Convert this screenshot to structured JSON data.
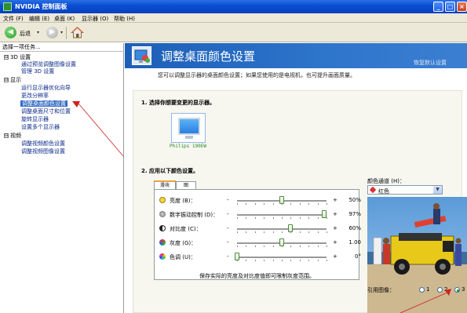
{
  "window": {
    "title": "NVIDIA 控制面板",
    "controls": {
      "minimize": "_",
      "maximize": "□",
      "close": "×"
    }
  },
  "menu": [
    "文件 (F)",
    "编辑 (E)",
    "桌面 (K)",
    "显示器 (O)",
    "帮助 (H)"
  ],
  "toolbar": {
    "back_label": "后退",
    "dropdown": "▾"
  },
  "sidebar": {
    "header": "选择一项任务...",
    "tree": [
      {
        "label": "3D 设置",
        "type": "group",
        "expander": "⊟"
      },
      {
        "label": "通过预览调整图像设置",
        "type": "link"
      },
      {
        "label": "管理 3D 设置",
        "type": "link"
      },
      {
        "label": "显示",
        "type": "group",
        "expander": "⊟"
      },
      {
        "label": "运行显示器优化向导",
        "type": "link"
      },
      {
        "label": "更改分辨率",
        "type": "link"
      },
      {
        "label": "调整桌面颜色设置",
        "type": "link",
        "selected": true
      },
      {
        "label": "调整桌面尺寸和位置",
        "type": "link"
      },
      {
        "label": "旋转显示器",
        "type": "link"
      },
      {
        "label": "设置多个显示器",
        "type": "link"
      },
      {
        "label": "视频",
        "type": "group",
        "expander": "⊟"
      },
      {
        "label": "调整视频颜色设置",
        "type": "link"
      },
      {
        "label": "调整视频图像设置",
        "type": "link"
      }
    ]
  },
  "main": {
    "title": "调整桌面颜色设置",
    "restore_defaults": "恢复默认设置",
    "description": "您可以调整显示器的桌面颜色设置；如果您使用的是电视机，也可提升画面质量。",
    "section1": "1.  选择你想要变更的显示器。",
    "monitor_label": "Philips 190EW",
    "section2": "2.  应用以下颜色设置。",
    "tabs": [
      "滑块",
      "图"
    ],
    "properties": [
      {
        "label": "亮度 (B)：",
        "value": "50%",
        "level": 0.5,
        "icon_color": "#e8c020",
        "icon": "sun-icon"
      },
      {
        "label": "数字振动控制 (D)：",
        "value": "97%",
        "level": 0.97,
        "icon_color": "#666666",
        "icon": "vibrance-icon"
      },
      {
        "label": "对比度 (C)：",
        "value": "60%",
        "level": 0.6,
        "icon_color": "#333333",
        "icon": "contrast-icon"
      },
      {
        "label": "灰度 (G)：",
        "value": "1.00",
        "level": 0.5,
        "icon_color": "#c04090",
        "icon": "gamma-icon"
      },
      {
        "label": "色调 (U)：",
        "value": "0°",
        "level": 0.0,
        "icon_color": "#d03838",
        "icon": "hue-icon"
      }
    ],
    "minus": "-",
    "plus": "+",
    "hint": "保存实际的亮度及对比度值即可限制灰度范围。",
    "color_channel_label": "颜色通道 (H)：",
    "color_channel_value": "红色",
    "reference_label": "引用图像：",
    "reference_options": [
      "1",
      "2",
      "3"
    ],
    "reference_selected": "3"
  },
  "colors": {
    "banner": "#2e75cc",
    "selected": "#316ac5",
    "annotation": "#d02020"
  }
}
